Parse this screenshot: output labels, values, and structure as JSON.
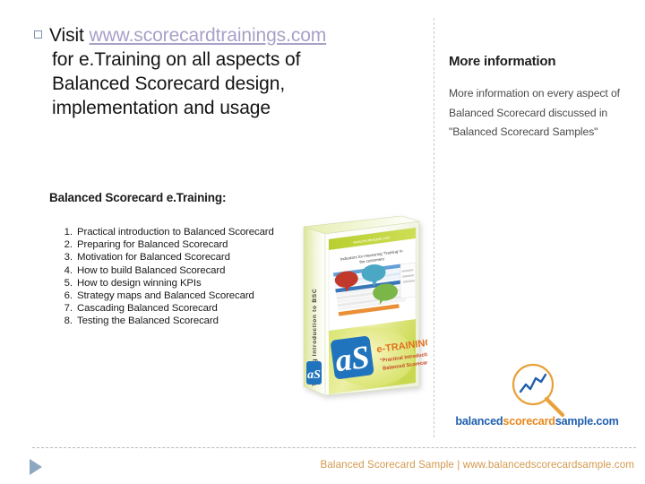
{
  "slide": {
    "headline": {
      "prefix": "Visit ",
      "link_text": "www.scorecardtrainings.com",
      "line2": "for e.Training on all aspects of",
      "line3": "Balanced Scorecard design,",
      "line4": "implementation and usage"
    },
    "subhead": "Balanced Scorecard e.Training:",
    "course_list": [
      "Practical introduction to Balanced Scorecard",
      "Preparing for Balanced Scorecard",
      "Motivation for Balanced Scorecard",
      "How to build Balanced Scorecard",
      "How to design winning KPIs",
      "Strategy maps and Balanced Scorecard",
      "Cascading Balanced Scorecard",
      "Testing the Balanced Scorecard"
    ],
    "right_panel": {
      "title": "More information",
      "body": "More information on every aspect of Balanced Scorecard discussed in \"Balanced Scorecard Samples\""
    },
    "boxart": {
      "spine_text": "Training Introduction to BSC",
      "top_url": "www.bscdesigner.com",
      "slide_title": "Indicators for measuring 'Training' in the customers'",
      "brand_mark": "aS",
      "product_label": "e-TRAINING",
      "product_sub_line1": "\"Practical Introduction to",
      "product_sub_line2": "Balanced Scorecard\""
    },
    "logo": {
      "word1": "balanced",
      "word2": "scorecard",
      "word3": "sample.com",
      "icon": "magnifying-glass-chart-icon"
    },
    "footer": {
      "text": "Balanced Scorecard Sample | www.balancedscorecardsample.com"
    },
    "colors": {
      "link": "#a9a0c8",
      "logo_blue": "#1f5fae",
      "logo_orange": "#e8881c",
      "footer_tan": "#d3994e",
      "bullet_outline": "#7f92ab",
      "play_triangle": "#8fa6c0"
    }
  }
}
